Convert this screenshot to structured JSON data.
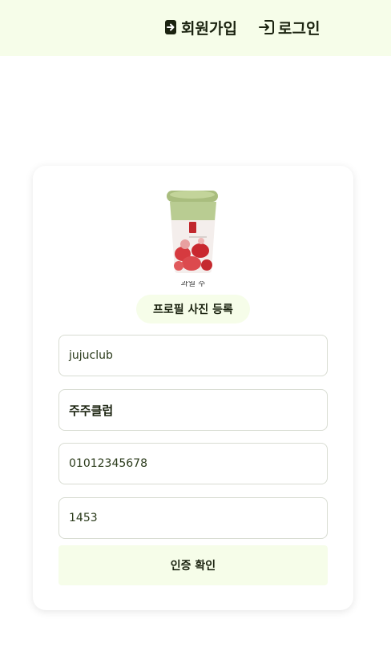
{
  "header": {
    "signup_label": "회원가입",
    "login_label": "로그인",
    "background_color": "#f6fde9"
  },
  "profile": {
    "image_icon": "strawberry-drink-cup-image",
    "image_caption": "과일 주",
    "upload_label": "프로필 사진 등록"
  },
  "form": {
    "user_id": "jujuclub",
    "nickname": "주주클럽",
    "phone": "01012345678",
    "verification_code": "1453",
    "verify_label": "인증 확인"
  },
  "colors": {
    "accent_bg": "#f6fde9",
    "text": "#1b2310"
  }
}
